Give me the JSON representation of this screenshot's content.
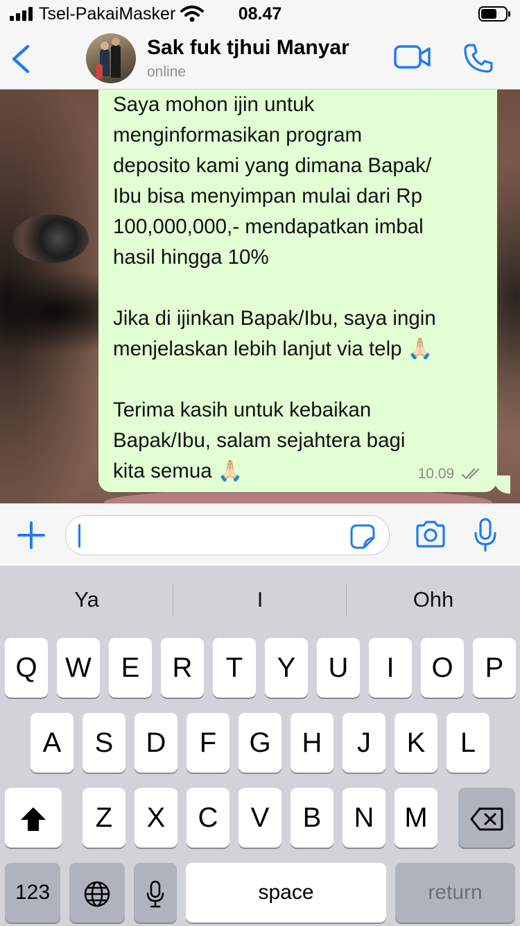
{
  "status_bar": {
    "carrier": "Tsel-PakaiMasker",
    "time": "08.47"
  },
  "header": {
    "contact_name": "Sak fuk tjhui Manyar",
    "status": "online",
    "icons": [
      "chevron-left-icon",
      "video-call-icon",
      "phone-icon"
    ]
  },
  "message": {
    "text": "Saya mohon ijin untuk\nmenginformasikan program\ndeposito kami yang dimana Bapak/\nIbu bisa menyimpan mulai dari Rp\n100,000,000,- mendapatkan imbal\nhasil hingga 10%\n\nJika di ijinkan Bapak/Ibu, saya ingin\nmenjelaskan lebih lanjut via telp 🙏🏻\n\nTerima kasih untuk kebaikan\nBapak/Ibu, salam sejahtera bagi\nkita semua 🙏🏻",
    "time": "10.09",
    "read_status": "double-check-icon"
  },
  "input": {
    "value": "",
    "icons": [
      "plus-icon",
      "sticker-icon",
      "camera-icon",
      "microphone-icon"
    ]
  },
  "keyboard": {
    "suggestions": [
      "Ya",
      "I",
      "Ohh"
    ],
    "row1": [
      "Q",
      "W",
      "E",
      "R",
      "T",
      "Y",
      "U",
      "I",
      "O",
      "P"
    ],
    "row2": [
      "A",
      "S",
      "D",
      "F",
      "G",
      "H",
      "J",
      "K",
      "L"
    ],
    "row3": [
      "Z",
      "X",
      "C",
      "V",
      "B",
      "N",
      "M"
    ],
    "numbers_label": "123",
    "space_label": "space",
    "return_label": "return",
    "colors": {
      "accent": "#1f7bf2",
      "bubble": "#e2ffd4",
      "keyboard_bg": "#d1d3d9"
    }
  }
}
